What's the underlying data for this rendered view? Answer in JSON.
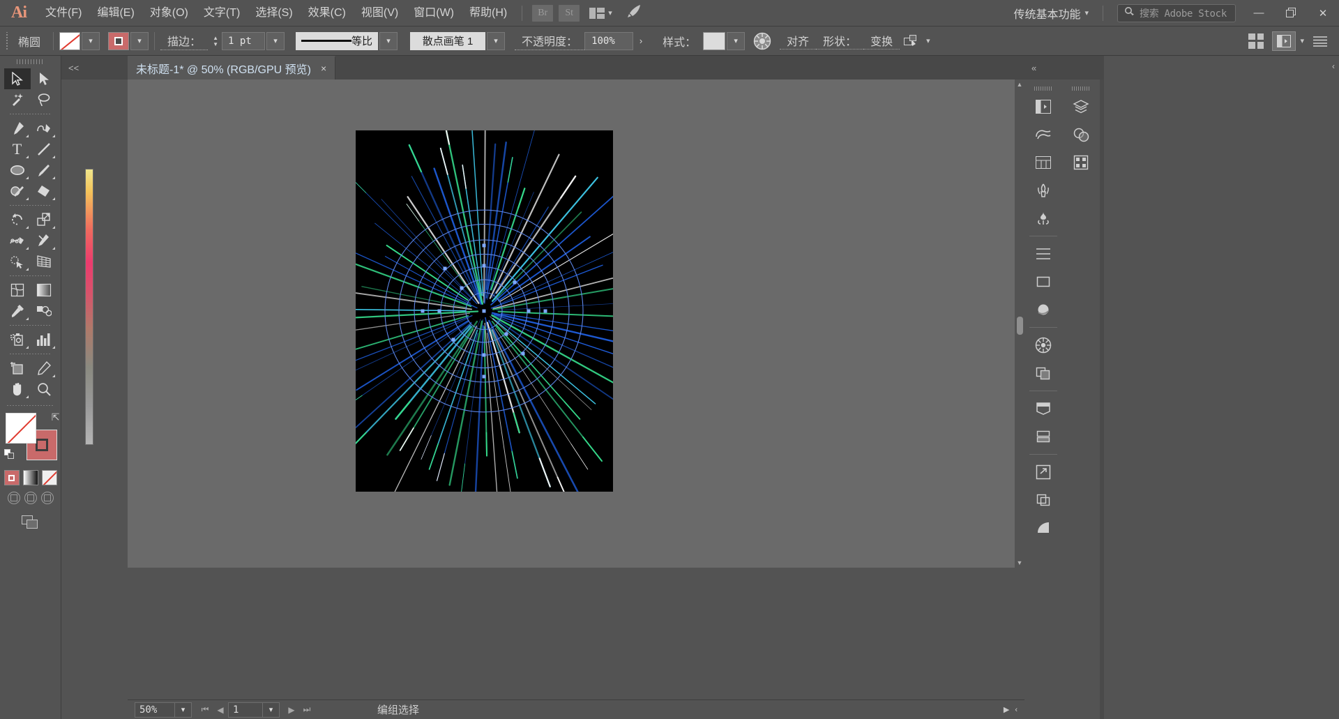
{
  "app": {
    "name": "Adobe Illustrator",
    "logo_text": "Ai",
    "accent": "#e8967a"
  },
  "menubar": {
    "items": [
      {
        "label": "文件(F)",
        "name": "menu-file"
      },
      {
        "label": "编辑(E)",
        "name": "menu-edit"
      },
      {
        "label": "对象(O)",
        "name": "menu-object"
      },
      {
        "label": "文字(T)",
        "name": "menu-type"
      },
      {
        "label": "选择(S)",
        "name": "menu-select"
      },
      {
        "label": "效果(C)",
        "name": "menu-effect"
      },
      {
        "label": "视图(V)",
        "name": "menu-view"
      },
      {
        "label": "窗口(W)",
        "name": "menu-window"
      },
      {
        "label": "帮助(H)",
        "name": "menu-help"
      }
    ],
    "bridge_label": "Br",
    "stock_label": "St",
    "arrange_icon": "arrange-documents-icon",
    "rocket_icon": "rocket-icon",
    "workspace": "传统基本功能",
    "search_placeholder": "搜索 Adobe Stock",
    "search_value": "",
    "window_buttons": {
      "minimize": "—",
      "restore": "❐",
      "close": "✕"
    }
  },
  "controlbar": {
    "object_type": "椭圆",
    "fill_label": "fill-swatch",
    "fill_value": "无",
    "stroke_swatch_label": "stroke-swatch",
    "stroke_color": "#c96a6a",
    "stroke_text": "描边：",
    "stroke_weight": "1 pt",
    "profile_label": "等比",
    "brush_label": "散点画笔 1",
    "opacity_text": "不透明度：",
    "opacity_value": "100%",
    "style_text": "样式：",
    "style_swatch": "#dcdcdc",
    "recolor_icon": "recolor-artwork-icon",
    "align_label": "对齐",
    "shape_label": "形状：",
    "transform_label": "变换",
    "arrange_icon": "arrange-objects-icon",
    "right_icons": [
      "grid-view-icon",
      "properties-panel-icon",
      "list-panel-icon"
    ]
  },
  "toolbar": {
    "tools": [
      {
        "name": "selection-tool",
        "label": "选择工具",
        "selected": true
      },
      {
        "name": "direct-selection-tool",
        "label": "直接选择工具",
        "selected": false
      },
      {
        "name": "magic-wand-tool",
        "label": "魔棒工具",
        "selected": false
      },
      {
        "name": "lasso-tool",
        "label": "套索工具",
        "selected": false
      },
      {
        "name": "pen-tool",
        "label": "钢笔工具",
        "selected": false
      },
      {
        "name": "curvature-tool",
        "label": "曲率工具",
        "selected": false
      },
      {
        "name": "type-tool",
        "label": "文字工具",
        "selected": false
      },
      {
        "name": "line-segment-tool",
        "label": "直线段工具",
        "selected": false
      },
      {
        "name": "ellipse-tool",
        "label": "椭圆工具",
        "selected": false
      },
      {
        "name": "paintbrush-tool",
        "label": "画笔工具",
        "selected": false
      },
      {
        "name": "shaper-tool",
        "label": "Shaper 工具",
        "selected": false
      },
      {
        "name": "eraser-tool",
        "label": "橡皮擦工具",
        "selected": false
      },
      {
        "name": "rotate-tool",
        "label": "旋转工具",
        "selected": false
      },
      {
        "name": "scale-tool",
        "label": "比例缩放工具",
        "selected": false
      },
      {
        "name": "width-tool",
        "label": "宽度工具",
        "selected": false
      },
      {
        "name": "free-transform-tool",
        "label": "自由变换工具",
        "selected": false
      },
      {
        "name": "shape-builder-tool",
        "label": "形状生成器工具",
        "selected": false
      },
      {
        "name": "perspective-grid-tool",
        "label": "透视网格工具",
        "selected": false
      },
      {
        "name": "mesh-tool",
        "label": "网格工具",
        "selected": false
      },
      {
        "name": "gradient-tool",
        "label": "渐变工具",
        "selected": false
      },
      {
        "name": "eyedropper-tool",
        "label": "吸管工具",
        "selected": false
      },
      {
        "name": "blend-tool",
        "label": "混合工具",
        "selected": false
      },
      {
        "name": "symbol-sprayer-tool",
        "label": "符号喷枪工具",
        "selected": false
      },
      {
        "name": "column-graph-tool",
        "label": "柱形图工具",
        "selected": false
      },
      {
        "name": "artboard-tool",
        "label": "画板工具",
        "selected": false
      },
      {
        "name": "slice-tool",
        "label": "切片工具",
        "selected": false
      },
      {
        "name": "hand-tool",
        "label": "抓手工具",
        "selected": false
      },
      {
        "name": "zoom-tool",
        "label": "缩放工具",
        "selected": false
      }
    ],
    "fill_color": "#ffffff",
    "fill_is_none": true,
    "stroke_color": "#c96a6a",
    "color_modes": [
      "color-mode-icon",
      "gradient-mode-icon",
      "none-mode-icon"
    ],
    "draw_modes": [
      "draw-normal-icon",
      "draw-behind-icon",
      "draw-inside-icon"
    ],
    "screen_mode": "change-screen-mode-icon"
  },
  "gradient_strip": {
    "name": "gradient-ramp",
    "colors": [
      "#f0e68c",
      "#ef6a5e",
      "#ec3b6e",
      "#b07a6a",
      "#b5b5b5"
    ]
  },
  "tabbar": {
    "collapse_label": "<<",
    "tabs": [
      {
        "title": "未标题-1* @ 50% (RGB/GPU 预览)",
        "close": "×",
        "active": true
      }
    ]
  },
  "canvas": {
    "artboard_background": "#000000",
    "artwork_name": "radial-burst-artwork",
    "artwork_description": "黑色画板上的放射状射线爆发图形，中心带同心圆环",
    "colors": {
      "ray_blue": "#1f5fe0",
      "ray_cyan": "#3ec8e8",
      "ray_green": "#35d98a",
      "ray_white": "#f2f2f2",
      "ring": "#5d86e8"
    }
  },
  "statusbar": {
    "zoom_value": "50%",
    "page_value": "1",
    "status_text": "编组选择",
    "first_icon": "first-page-icon",
    "prev_icon": "previous-page-icon",
    "next_icon": "next-page-icon",
    "last_icon": "last-page-icon"
  },
  "rightdock": {
    "collapse_label": "«",
    "column_a": [
      {
        "name": "properties-panel-icon"
      },
      {
        "name": "libraries-panel-icon"
      },
      {
        "name": "artboards-panel-icon"
      },
      {
        "name": "brushes-panel-icon"
      },
      {
        "name": "symbols-panel-icon"
      },
      {
        "name": "align-panel-icon"
      },
      {
        "name": "appearance-panel-icon"
      },
      {
        "name": "graphic-styles-panel-icon"
      },
      {
        "name": "transparency-panel-icon"
      },
      {
        "name": "pathfinder-panel-icon"
      },
      {
        "name": "artboard-panel-icon"
      },
      {
        "name": "layers-compact-icon"
      },
      {
        "name": "asset-export-panel-icon"
      },
      {
        "name": "document-info-panel-icon"
      },
      {
        "name": "gradient-panel-icon"
      }
    ],
    "column_b": [
      {
        "name": "layers-panel-icon"
      },
      {
        "name": "color-guide-panel-icon"
      },
      {
        "name": "swatches-panel-icon"
      }
    ]
  }
}
